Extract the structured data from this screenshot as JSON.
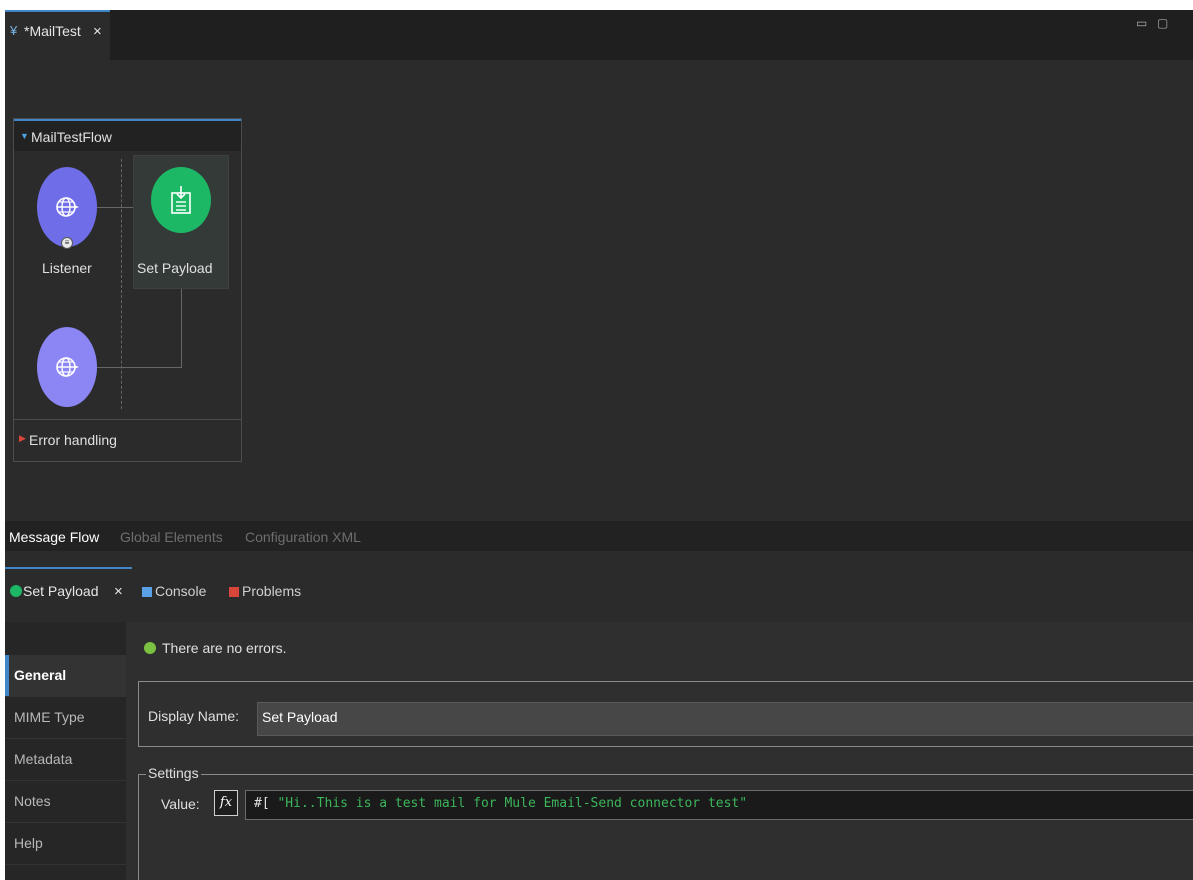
{
  "editor": {
    "tab_label": "*MailTest",
    "tab_close": "×"
  },
  "window_controls": {
    "minimize": "▭",
    "maximize": "▢"
  },
  "flow": {
    "name": "MailTestFlow",
    "nodes": [
      {
        "label": "Listener",
        "icon": "globe-icon",
        "color": "#6f6ee8"
      },
      {
        "label": "Set Payload",
        "icon": "set-payload-icon",
        "color": "#1db865"
      },
      {
        "label": "",
        "icon": "globe-icon",
        "color": "#8b86f3"
      }
    ],
    "error_handling": "Error handling"
  },
  "editor_tabs": {
    "message_flow": "Message Flow",
    "global_elements": "Global Elements",
    "configuration_xml": "Configuration XML"
  },
  "properties": {
    "active_tab": "Set Payload",
    "tab_close": "×",
    "other_tabs": [
      "Console",
      "Problems"
    ],
    "status": "There are no errors.",
    "sidebar": [
      "General",
      "MIME Type",
      "Metadata",
      "Notes",
      "Help"
    ],
    "display_name_label": "Display Name:",
    "display_name_value": "Set Payload",
    "settings_legend": "Settings",
    "value_label": "Value:",
    "fx_label": "fx",
    "value_prefix": "#[ ",
    "value_string": "\"Hi..This is a test mail for Mule Email-Send connector test\""
  },
  "colors": {
    "accent": "#3f86c6",
    "set_payload_green": "#1db865",
    "listener_purple": "#6f6ee8",
    "error_red": "#d9463a",
    "string_green": "#3cb55b"
  }
}
